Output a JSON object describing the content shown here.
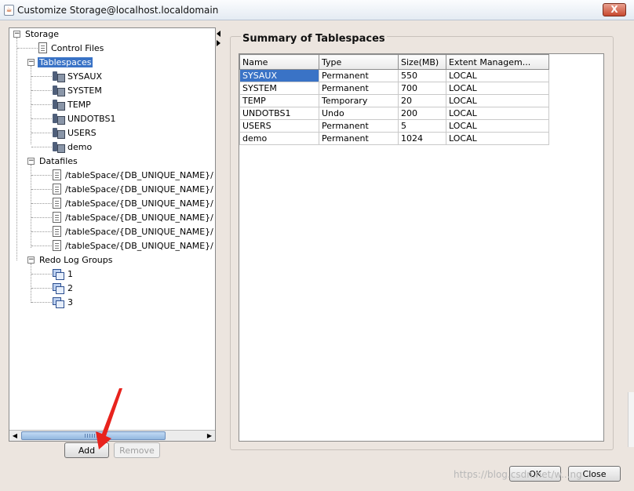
{
  "window": {
    "title": "Customize Storage@localhost.localdomain",
    "close_label": "X"
  },
  "tree": {
    "root": "Storage",
    "control_files": "Control Files",
    "tablespaces": {
      "label": "Tablespaces",
      "items": [
        "SYSAUX",
        "SYSTEM",
        "TEMP",
        "UNDOTBS1",
        "USERS",
        "demo"
      ]
    },
    "datafiles": {
      "label": "Datafiles",
      "items": [
        "/tableSpace/{DB_UNIQUE_NAME}/",
        "/tableSpace/{DB_UNIQUE_NAME}/",
        "/tableSpace/{DB_UNIQUE_NAME}/",
        "/tableSpace/{DB_UNIQUE_NAME}/",
        "/tableSpace/{DB_UNIQUE_NAME}/",
        "/tableSpace/{DB_UNIQUE_NAME}/"
      ]
    },
    "redo": {
      "label": "Redo Log Groups",
      "items": [
        "1",
        "2",
        "3"
      ]
    }
  },
  "buttons": {
    "add": "Add",
    "remove": "Remove",
    "ok": "OK",
    "close": "Close"
  },
  "summary": {
    "title": "Summary of Tablespaces",
    "columns": [
      "Name",
      "Type",
      "Size(MB)",
      "Extent Managem..."
    ],
    "rows": [
      [
        "SYSAUX",
        "Permanent",
        "550",
        "LOCAL"
      ],
      [
        "SYSTEM",
        "Permanent",
        "700",
        "LOCAL"
      ],
      [
        "TEMP",
        "Temporary",
        "20",
        "LOCAL"
      ],
      [
        "UNDOTBS1",
        "Undo",
        "200",
        "LOCAL"
      ],
      [
        "USERS",
        "Permanent",
        "5",
        "LOCAL"
      ],
      [
        "demo",
        "Permanent",
        "1024",
        "LOCAL"
      ]
    ]
  },
  "watermark": "https://blog.csdn.net/w...ng",
  "colors": {
    "selection": "#3a73c6",
    "background": "#ece5df",
    "annotation": "#e8231d"
  }
}
